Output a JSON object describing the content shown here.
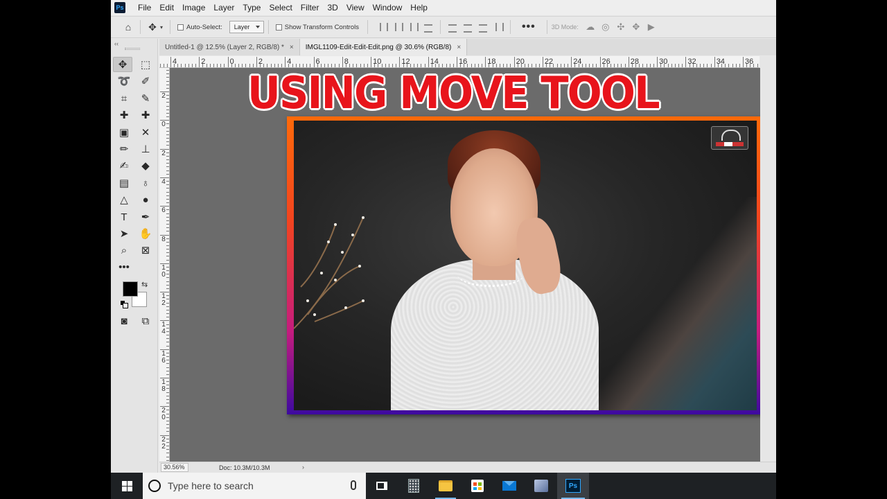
{
  "menubar": {
    "logo": "Ps",
    "items": [
      "File",
      "Edit",
      "Image",
      "Layer",
      "Type",
      "Select",
      "Filter",
      "3D",
      "View",
      "Window",
      "Help"
    ]
  },
  "options": {
    "auto_select_label": "Auto-Select:",
    "auto_select_value": "Layer",
    "show_transform_label": "Show Transform Controls",
    "more_label": "•••",
    "mode_3d_label": "3D Mode:"
  },
  "tabs": [
    {
      "label": "Untitled-1 @ 12.5% (Layer 2, RGB/8) *",
      "close": "×"
    },
    {
      "label": "IMGL1109-Edit-Edit-Edit.png @ 30.6% (RGB/8)",
      "close": "×"
    }
  ],
  "ruler_top": [
    "4",
    "2",
    "0",
    "2",
    "4",
    "6",
    "8",
    "10",
    "12",
    "14",
    "16",
    "18",
    "20",
    "22",
    "24",
    "26",
    "28",
    "30",
    "32",
    "34",
    "36"
  ],
  "ruler_left": [
    "2",
    "0",
    "2",
    "4",
    "6",
    "8",
    "1 0",
    "1 2",
    "1 4",
    "1 6",
    "1 8",
    "2 0",
    "2 2"
  ],
  "canvas": {
    "overlay_title": "USING MOVE TOOL"
  },
  "toolbar": {
    "collapse": "‹‹",
    "more_tools": "•••",
    "swap": "⇆"
  },
  "status": {
    "zoom": "30.56%",
    "doc_info": "Doc: 10.3M/10.3M",
    "arrow": "›"
  },
  "taskbar": {
    "search_placeholder": "Type here to search",
    "ps_label": "Ps"
  },
  "colors": {
    "foreground": "#000000",
    "background": "#ffffff",
    "title_red": "#e8141b",
    "frame_top": "#ff6a0a",
    "frame_bottom": "#3d0aa0"
  }
}
